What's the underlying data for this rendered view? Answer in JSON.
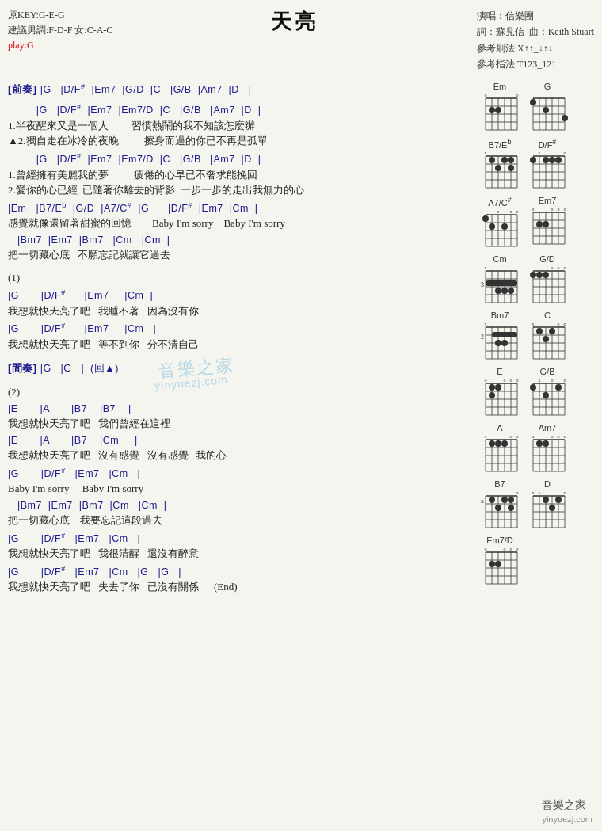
{
  "title": "天亮",
  "header": {
    "key_info": "原KEY:G-E-G",
    "suggest_male": "建議男調:F-D-F",
    "suggest_female": "女:C-A-C",
    "play": "play:G",
    "performer": "演唱：信樂團",
    "lyricist": "詞：蘇見信",
    "composer": "曲：Keith Stuart",
    "strum_ref": "參考刷法:X↑↑_↓↑↓",
    "finger_ref": "參考指法:T123_121"
  },
  "watermark": "音樂之家",
  "watermark_url": "yinyuezj.com",
  "footer": "音樂之家\nyinyuezj.com"
}
